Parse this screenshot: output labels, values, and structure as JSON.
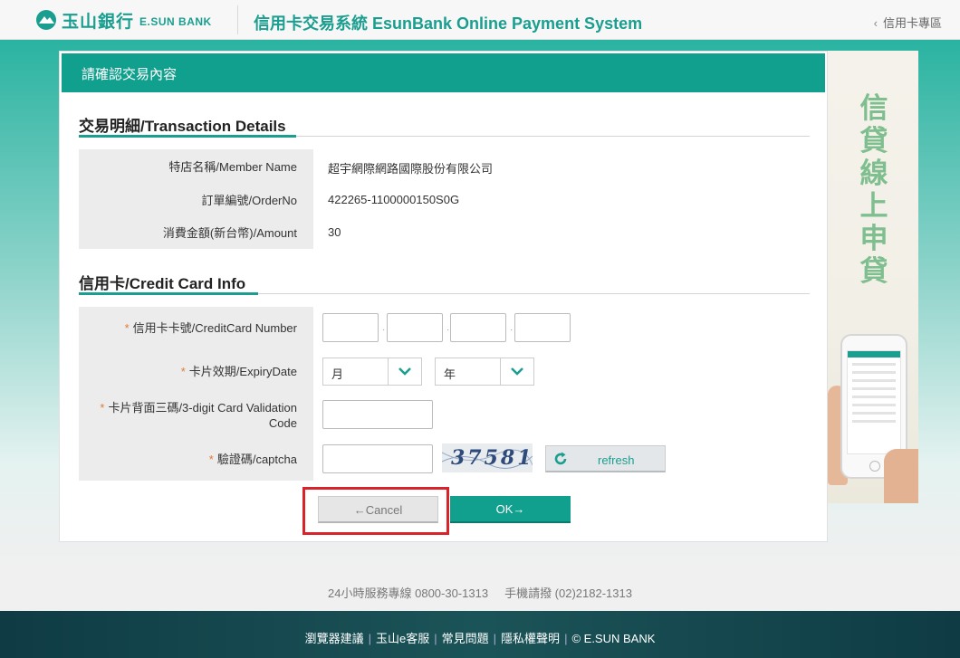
{
  "header": {
    "logo_text": "玉山銀行",
    "logo_sub": "E.SUN BANK",
    "system_title": "信用卡交易系統 EsunBank Online Payment System",
    "back_link": "信用卡專區"
  },
  "card": {
    "title": "請確認交易內容",
    "transaction": {
      "section_title": "交易明細/Transaction Details",
      "rows": [
        {
          "label": "特店名稱/Member Name",
          "value": "超宇網際網路國際股份有限公司"
        },
        {
          "label": "訂單編號/OrderNo",
          "value": "422265-1100000150S0G"
        },
        {
          "label": "消費金額(新台幣)/Amount",
          "value": "30"
        }
      ]
    },
    "credit": {
      "section_title": "信用卡/Credit Card Info",
      "required_mark": "*",
      "card_number_label": "信用卡卡號/CreditCard Number",
      "expiry_label": "卡片效期/ExpiryDate",
      "month_value": "月",
      "year_value": "年",
      "cvc_label": "卡片背面三碼/3-digit Card Validation Code",
      "captcha_label": "驗證碼/captcha",
      "captcha_image_text": "37581",
      "refresh_label": "refresh"
    },
    "buttons": {
      "cancel": "←Cancel",
      "ok": "OK→"
    }
  },
  "banner": {
    "text": "信貸線上申貸"
  },
  "footer": {
    "hotline": "24小時服務專線 0800-30-1313",
    "mobile": "手機請撥 (02)2182-1313",
    "links": [
      "瀏覽器建議",
      "玉山e客服",
      "常見問題",
      "隱私權聲明",
      "© E.SUN BANK"
    ]
  },
  "colors": {
    "brand": "#1a9e8f",
    "header_bar": "#12a08e",
    "highlight": "#d8232a",
    "required": "#e07a36"
  }
}
